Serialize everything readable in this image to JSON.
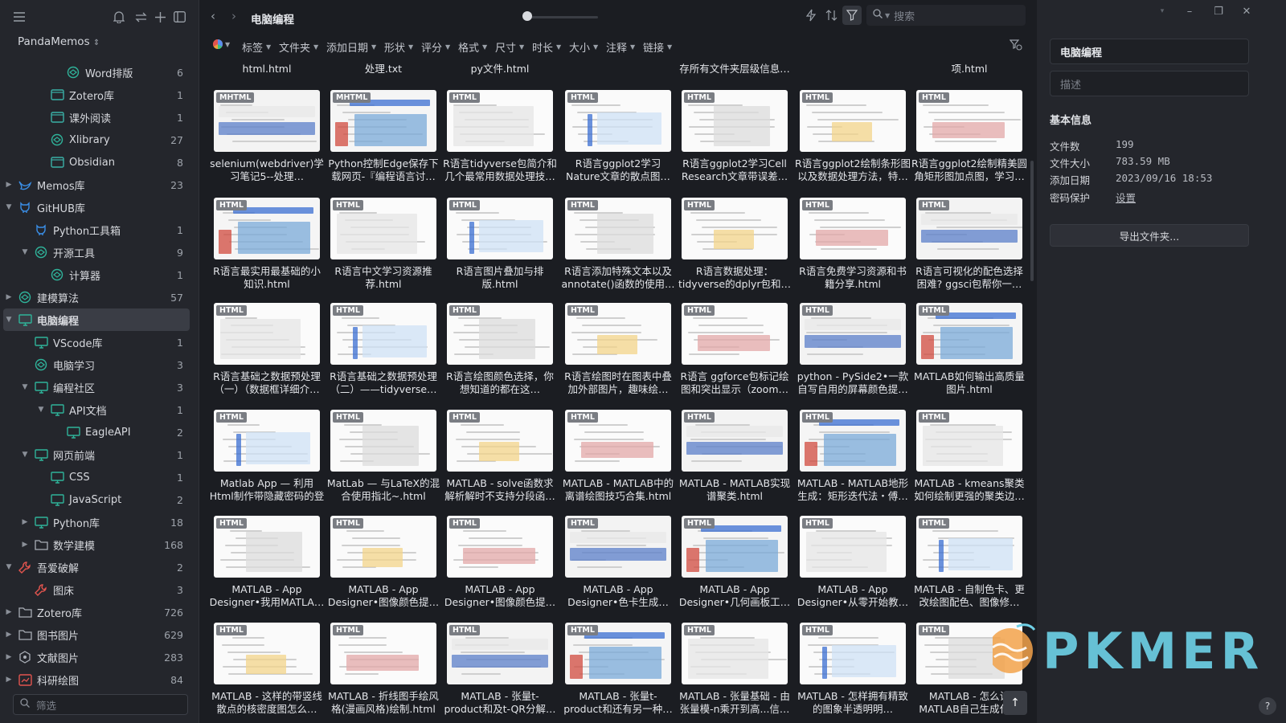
{
  "app": {
    "library_name": "PandaMemos",
    "watermark": "PKMER"
  },
  "sidebar": {
    "filter_placeholder": "筛选",
    "items": [
      {
        "label": "Word排版",
        "count": "6"
      },
      {
        "label": "Zotero库",
        "count": "1"
      },
      {
        "label": "课外阅读",
        "count": "1"
      },
      {
        "label": "Xlibrary",
        "count": "27"
      },
      {
        "label": "Obsidian",
        "count": "8"
      },
      {
        "label": "Memos库",
        "count": "23"
      },
      {
        "label": "GitHUB库",
        "count": ""
      },
      {
        "label": "Python工具箱",
        "count": "1"
      },
      {
        "label": "开源工具",
        "count": "9"
      },
      {
        "label": "计算器",
        "count": "1"
      },
      {
        "label": "建模算法",
        "count": "57"
      },
      {
        "label": "电脑编程",
        "count": ""
      },
      {
        "label": "VScode库",
        "count": "1"
      },
      {
        "label": "电脑学习",
        "count": "3"
      },
      {
        "label": "编程社区",
        "count": "3"
      },
      {
        "label": "API文档",
        "count": "1"
      },
      {
        "label": "EagleAPI",
        "count": "2"
      },
      {
        "label": "网页前端",
        "count": "1"
      },
      {
        "label": "CSS",
        "count": "1"
      },
      {
        "label": "JavaScript",
        "count": "2"
      },
      {
        "label": "Python库",
        "count": "18"
      },
      {
        "label": "数学建模",
        "count": "168"
      },
      {
        "label": "吾爱破解",
        "count": "2"
      },
      {
        "label": "图床",
        "count": "3"
      },
      {
        "label": "Zotero库",
        "count": "726"
      },
      {
        "label": "图书图片",
        "count": "629"
      },
      {
        "label": "文献图片",
        "count": "283"
      },
      {
        "label": "科研绘图",
        "count": "84"
      }
    ]
  },
  "toolbar": {
    "folder_title": "电脑编程",
    "search_placeholder": "搜索",
    "filters": [
      "标签",
      "文件夹",
      "添加日期",
      "形状",
      "评分",
      "格式",
      "尺寸",
      "时长",
      "大小",
      "注释",
      "链接"
    ]
  },
  "grid": {
    "top_titles": [
      "html.html",
      "处理.txt",
      "py文件.html",
      "",
      "存所有文件夹层级信息…",
      "",
      "项.html"
    ],
    "rows": [
      [
        {
          "badge": "MHTML",
          "title": "selenium(webdriver)学习笔记5--处理…"
        },
        {
          "badge": "MHTML",
          "title": "Python控制Edge保存下载网页-『编程语言讨…"
        },
        {
          "badge": "HTML",
          "title": "R语言tidyverse包简介和几个最常用数据处理技…"
        },
        {
          "badge": "HTML",
          "title": "R语言ggplot2学习Nature文章的散点图…"
        },
        {
          "badge": "HTML",
          "title": "R语言ggplot2学习Cell Research文章带误差…"
        },
        {
          "badge": "HTML",
          "title": "R语言ggplot2绘制条形图以及数据处理方法，特…"
        },
        {
          "badge": "HTML",
          "title": "R语言ggplot2绘制精美圆角矩形图加点图，学习…"
        }
      ],
      [
        {
          "badge": "HTML",
          "title": "R语言最实用最基础的小知识.html"
        },
        {
          "badge": "HTML",
          "title": "R语言中文学习资源推荐.html"
        },
        {
          "badge": "HTML",
          "title": "R语言图片叠加与排版.html"
        },
        {
          "badge": "HTML",
          "title": "R语言添加特殊文本以及annotate()函数的使用…"
        },
        {
          "badge": "HTML",
          "title": "R语言数据处理：tidyverse的dplyr包和…"
        },
        {
          "badge": "HTML",
          "title": "R语言免费学习资源和书籍分享.html"
        },
        {
          "badge": "HTML",
          "title": "R语言可视化的配色选择困难? ggsci包帮你一…"
        }
      ],
      [
        {
          "badge": "HTML",
          "title": "R语言基础之数据预处理（一）（数据框详细介…"
        },
        {
          "badge": "HTML",
          "title": "R语言基础之数据预处理（二）——tidyverse…"
        },
        {
          "badge": "HTML",
          "title": "R语言绘图颜色选择，你想知道的都在这…"
        },
        {
          "badge": "HTML",
          "title": "R语言绘图时在图表中叠加外部图片，趣味绘…"
        },
        {
          "badge": "HTML",
          "title": "R语言 ggforce包标记绘图和突出显示（zoom…"
        },
        {
          "badge": "HTML",
          "title": "python - PySide2•一款自写自用的屏幕颜色提…"
        },
        {
          "badge": "HTML",
          "title": "MATLAB如何输出高质量图片.html"
        }
      ],
      [
        {
          "badge": "HTML",
          "title": "Matlab App — 利用Html制作带隐藏密码的登录…"
        },
        {
          "badge": "HTML",
          "title": "MatLab — 与LaTeX的混合使用指北~.html"
        },
        {
          "badge": "HTML",
          "title": "MATLAB - solve函数求解析解时不支持分段函…"
        },
        {
          "badge": "HTML",
          "title": "MATLAB - MATLAB中的离谱绘图技巧合集.html"
        },
        {
          "badge": "HTML",
          "title": "MATLAB - MATLAB实现谱聚类.html"
        },
        {
          "badge": "HTML",
          "title": "MATLAB - MATLAB地形生成：矩形迭代法・傅…"
        },
        {
          "badge": "HTML",
          "title": "MATLAB - kmeans聚类如何绘制更强的聚类边…"
        }
      ],
      [
        {
          "badge": "HTML",
          "title": "MATLAB - App Designer•我用MATLA…"
        },
        {
          "badge": "HTML",
          "title": "MATLAB - App Designer•图像颜色提…"
        },
        {
          "badge": "HTML",
          "title": "MATLAB - App Designer•图像颜色提…"
        },
        {
          "badge": "HTML",
          "title": "MATLAB - App Designer•色卡生成…"
        },
        {
          "badge": "HTML",
          "title": "MATLAB - App Designer•几何画板工…"
        },
        {
          "badge": "HTML",
          "title": "MATLAB - App Designer•从零开始教…"
        },
        {
          "badge": "HTML",
          "title": "MATLAB - 自制色卡、更改绘图配色、图像修…"
        }
      ],
      [
        {
          "badge": "HTML",
          "title": "MATLAB - 这样的带竖线散点的核密度图怎么…"
        },
        {
          "badge": "HTML",
          "title": "MATLAB - 折线图手绘风格(漫画风格)绘制.html"
        },
        {
          "badge": "HTML",
          "title": "MATLAB - 张量t-product和及t-QR分解…"
        },
        {
          "badge": "HTML",
          "title": "MATLAB - 张量t-product和还有另一种…"
        },
        {
          "badge": "HTML",
          "title": "MATLAB - 张量基础 - 由张量模-n乘开到高...信…"
        },
        {
          "badge": "HTML",
          "title": "MATLAB - 怎样拥有精致的图象半透明明…"
        },
        {
          "badge": "HTML",
          "title": "MATLAB - 怎么让MATLAB自己生成代…"
        }
      ]
    ]
  },
  "panel": {
    "name_value": "电脑编程",
    "desc_placeholder": "描述",
    "info_title": "基本信息",
    "info": [
      {
        "key": "文件数",
        "value": "199"
      },
      {
        "key": "文件大小",
        "value": "783.59 MB"
      },
      {
        "key": "添加日期",
        "value": "2023/09/16 18:53"
      },
      {
        "key": "密码保护",
        "value": "设置"
      }
    ],
    "export_label": "导出文件夹..."
  },
  "colors": {
    "teal": "#2fb39a",
    "folder": "#3ab0a6",
    "red": "#e2544e",
    "blue": "#3a8ee6",
    "selected": "#3a3d45"
  }
}
